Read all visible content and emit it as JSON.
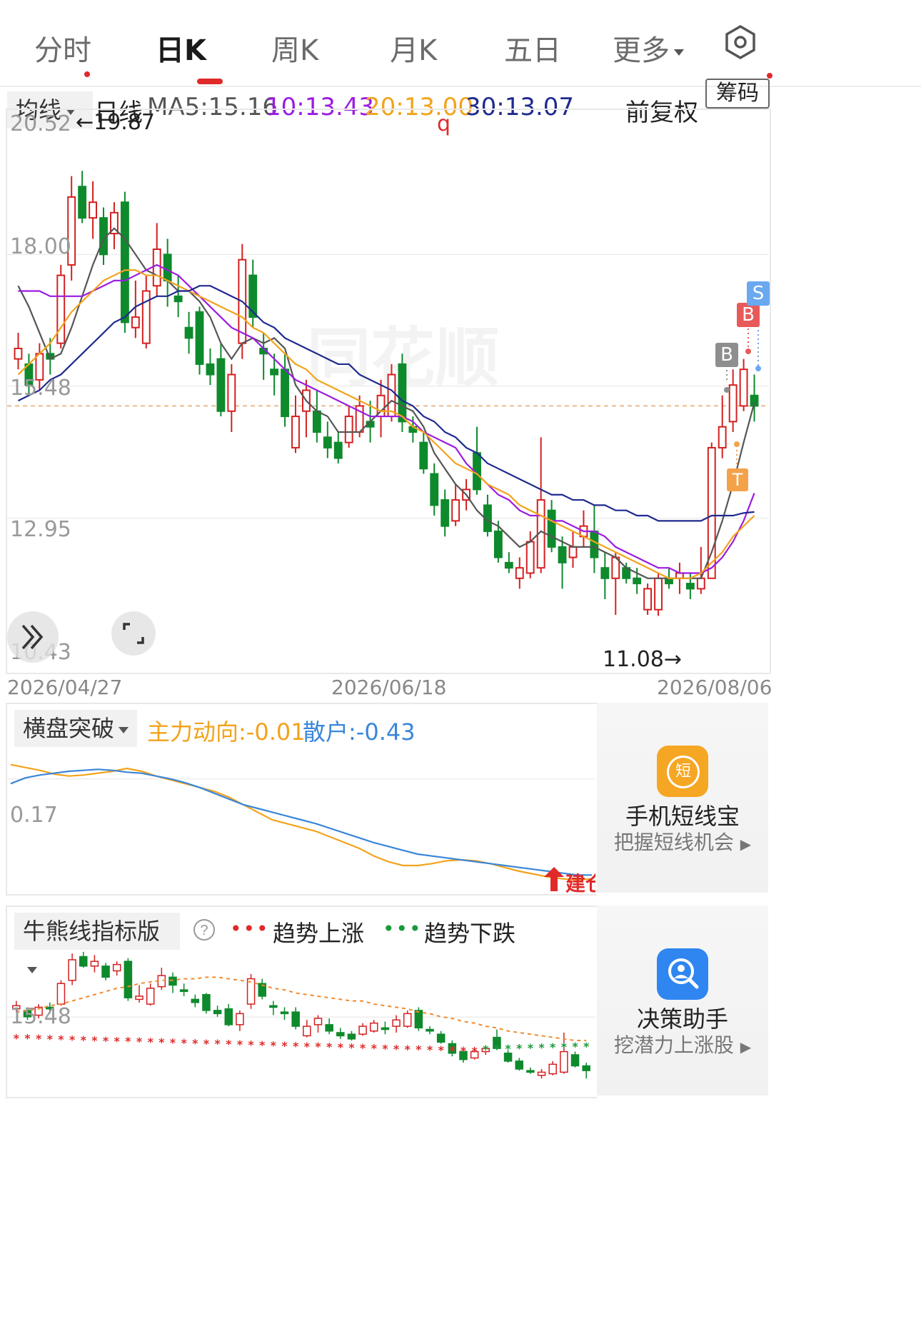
{
  "tabs": [
    {
      "label": "分时"
    },
    {
      "label": "日K"
    },
    {
      "label": "周K"
    },
    {
      "label": "月K"
    },
    {
      "label": "五日"
    },
    {
      "label": "更多"
    }
  ],
  "active_tab": "日K",
  "settings_icon": "hexagon-settings-icon",
  "ma_bar": {
    "selector": "均线",
    "period": "日线",
    "ma5": "MA5:15.16",
    "ma10": "10:13.43",
    "ma20": "20:13.00",
    "ma30": "30:13.07",
    "adjust": "前复权",
    "chips_button": "筹码",
    "colors": {
      "ma5": "#555555",
      "ma10": "#9b1ce0",
      "ma20": "#f2a31b",
      "ma30": "#1f2a8f"
    }
  },
  "main_chart": {
    "y_ticks": [
      "20.52",
      "18.00",
      "15.48",
      "12.95",
      "10.43"
    ],
    "x_dates": [
      "2026/04/27",
      "2026/06/18",
      "2026/08/06"
    ],
    "max_label": "←19.87",
    "min_label": "11.08→",
    "marker_top": "q",
    "signals": [
      "B",
      "B",
      "S",
      "T"
    ],
    "watermark": "同花顺"
  },
  "chart_data": {
    "type": "candlestick",
    "ylim": [
      10.43,
      20.52
    ],
    "candles": [
      {
        "o": 16.0,
        "c": 16.2,
        "h": 16.5,
        "l": 15.8
      },
      {
        "o": 15.9,
        "c": 15.5,
        "h": 16.1,
        "l": 15.3
      },
      {
        "o": 15.6,
        "c": 16.1,
        "h": 16.3,
        "l": 15.4
      },
      {
        "o": 16.1,
        "c": 16.0,
        "h": 16.4,
        "l": 15.7
      },
      {
        "o": 16.3,
        "c": 17.6,
        "h": 17.8,
        "l": 16.2
      },
      {
        "o": 17.8,
        "c": 19.1,
        "h": 19.5,
        "l": 17.5
      },
      {
        "o": 19.3,
        "c": 18.7,
        "h": 19.6,
        "l": 18.6
      },
      {
        "o": 18.7,
        "c": 19.0,
        "h": 19.4,
        "l": 18.3
      },
      {
        "o": 18.7,
        "c": 18.0,
        "h": 18.9,
        "l": 17.8
      },
      {
        "o": 18.4,
        "c": 18.8,
        "h": 19.0,
        "l": 18.1
      },
      {
        "o": 19.0,
        "c": 16.7,
        "h": 19.2,
        "l": 16.5
      },
      {
        "o": 16.6,
        "c": 16.8,
        "h": 17.5,
        "l": 16.4
      },
      {
        "o": 16.3,
        "c": 17.3,
        "h": 17.6,
        "l": 16.2
      },
      {
        "o": 17.4,
        "c": 18.1,
        "h": 18.6,
        "l": 17.2
      },
      {
        "o": 18.0,
        "c": 17.5,
        "h": 18.3,
        "l": 17.0
      },
      {
        "o": 17.2,
        "c": 17.1,
        "h": 17.6,
        "l": 16.8
      },
      {
        "o": 16.6,
        "c": 16.4,
        "h": 16.9,
        "l": 16.1
      },
      {
        "o": 16.9,
        "c": 15.9,
        "h": 17.0,
        "l": 15.7
      },
      {
        "o": 15.9,
        "c": 15.7,
        "h": 16.2,
        "l": 15.5
      },
      {
        "o": 16.0,
        "c": 15.0,
        "h": 16.3,
        "l": 14.9
      },
      {
        "o": 15.0,
        "c": 15.7,
        "h": 15.9,
        "l": 14.6
      },
      {
        "o": 16.3,
        "c": 17.9,
        "h": 18.2,
        "l": 16.0
      },
      {
        "o": 17.6,
        "c": 16.8,
        "h": 17.9,
        "l": 16.6
      },
      {
        "o": 16.2,
        "c": 16.1,
        "h": 16.5,
        "l": 15.6
      },
      {
        "o": 15.8,
        "c": 15.7,
        "h": 16.1,
        "l": 15.3
      },
      {
        "o": 15.8,
        "c": 14.9,
        "h": 16.1,
        "l": 14.7
      },
      {
        "o": 14.3,
        "c": 14.9,
        "h": 15.3,
        "l": 14.2
      },
      {
        "o": 15.0,
        "c": 15.4,
        "h": 15.6,
        "l": 14.5
      },
      {
        "o": 15.0,
        "c": 14.6,
        "h": 15.4,
        "l": 14.4
      },
      {
        "o": 14.5,
        "c": 14.3,
        "h": 14.8,
        "l": 14.1
      },
      {
        "o": 14.4,
        "c": 14.1,
        "h": 14.6,
        "l": 14.0
      },
      {
        "o": 14.4,
        "c": 14.9,
        "h": 15.1,
        "l": 14.3
      },
      {
        "o": 14.6,
        "c": 15.1,
        "h": 15.3,
        "l": 14.5
      },
      {
        "o": 14.8,
        "c": 14.7,
        "h": 15.2,
        "l": 14.4
      },
      {
        "o": 14.9,
        "c": 15.3,
        "h": 15.6,
        "l": 14.5
      },
      {
        "o": 14.9,
        "c": 15.7,
        "h": 15.9,
        "l": 14.8
      },
      {
        "o": 15.9,
        "c": 14.8,
        "h": 16.1,
        "l": 14.6
      },
      {
        "o": 14.7,
        "c": 14.6,
        "h": 14.9,
        "l": 14.4
      },
      {
        "o": 14.4,
        "c": 13.9,
        "h": 14.6,
        "l": 13.8
      },
      {
        "o": 13.8,
        "c": 13.2,
        "h": 14.0,
        "l": 13.0
      },
      {
        "o": 13.3,
        "c": 12.8,
        "h": 13.5,
        "l": 12.6
      },
      {
        "o": 12.9,
        "c": 13.3,
        "h": 13.6,
        "l": 12.8
      },
      {
        "o": 13.3,
        "c": 13.5,
        "h": 13.7,
        "l": 13.1
      },
      {
        "o": 14.2,
        "c": 13.5,
        "h": 14.7,
        "l": 13.4
      },
      {
        "o": 13.2,
        "c": 12.7,
        "h": 13.4,
        "l": 12.6
      },
      {
        "o": 12.7,
        "c": 12.2,
        "h": 12.9,
        "l": 12.1
      },
      {
        "o": 12.1,
        "c": 12.0,
        "h": 12.3,
        "l": 11.9
      },
      {
        "o": 11.8,
        "c": 12.0,
        "h": 12.2,
        "l": 11.6
      },
      {
        "o": 11.9,
        "c": 12.5,
        "h": 12.7,
        "l": 11.8
      },
      {
        "o": 12.0,
        "c": 13.3,
        "h": 14.5,
        "l": 11.9
      },
      {
        "o": 13.1,
        "c": 12.4,
        "h": 13.3,
        "l": 12.3
      },
      {
        "o": 12.4,
        "c": 12.1,
        "h": 12.6,
        "l": 11.6
      },
      {
        "o": 12.2,
        "c": 12.4,
        "h": 12.7,
        "l": 12.0
      },
      {
        "o": 12.6,
        "c": 12.8,
        "h": 13.1,
        "l": 12.4
      },
      {
        "o": 12.7,
        "c": 12.2,
        "h": 13.2,
        "l": 11.9
      },
      {
        "o": 12.0,
        "c": 11.8,
        "h": 12.3,
        "l": 11.4
      },
      {
        "o": 11.8,
        "c": 12.2,
        "h": 12.3,
        "l": 11.1
      },
      {
        "o": 12.0,
        "c": 11.8,
        "h": 12.1,
        "l": 11.7
      },
      {
        "o": 11.8,
        "c": 11.7,
        "h": 12.0,
        "l": 11.5
      },
      {
        "o": 11.2,
        "c": 11.6,
        "h": 11.7,
        "l": 11.1
      },
      {
        "o": 11.2,
        "c": 11.8,
        "h": 11.9,
        "l": 11.08
      },
      {
        "o": 11.8,
        "c": 11.7,
        "h": 12.0,
        "l": 11.6
      },
      {
        "o": 11.8,
        "c": 11.9,
        "h": 12.1,
        "l": 11.5
      },
      {
        "o": 11.7,
        "c": 11.6,
        "h": 11.9,
        "l": 11.4
      },
      {
        "o": 11.6,
        "c": 11.8,
        "h": 12.4,
        "l": 11.5
      },
      {
        "o": 11.8,
        "c": 14.3,
        "h": 14.4,
        "l": 11.8
      },
      {
        "o": 14.3,
        "c": 14.7,
        "h": 15.3,
        "l": 14.1
      },
      {
        "o": 14.8,
        "c": 15.5,
        "h": 15.8,
        "l": 14.6
      },
      {
        "o": 15.1,
        "c": 15.8,
        "h": 16.0,
        "l": 15.0
      },
      {
        "o": 15.3,
        "c": 15.1,
        "h": 15.7,
        "l": 14.8
      }
    ],
    "series": [
      {
        "name": "MA5",
        "color": "#555555",
        "values": [
          17.4,
          17.0,
          16.5,
          16.0,
          16.1,
          16.6,
          17.2,
          17.8,
          18.3,
          18.5,
          18.3,
          18.0,
          17.7,
          17.6,
          17.5,
          17.3,
          17.3,
          17.1,
          16.8,
          16.3,
          16.0,
          16.3,
          16.4,
          16.3,
          16.4,
          16.2,
          15.5,
          15.2,
          15.0,
          14.9,
          14.6,
          14.6,
          14.6,
          14.8,
          15.0,
          15.2,
          15.1,
          15.0,
          14.7,
          14.2,
          13.9,
          13.6,
          13.4,
          13.1,
          12.9,
          12.8,
          12.6,
          12.4,
          12.5,
          12.7,
          12.6,
          12.5,
          12.4,
          12.4,
          12.4,
          12.3,
          12.2,
          12.0,
          11.9,
          11.8,
          11.8,
          11.8,
          11.8,
          11.8,
          11.8,
          12.3,
          12.9,
          13.6,
          14.4,
          15.16
        ]
      },
      {
        "name": "MA10",
        "color": "#9b1ce0",
        "values": [
          17.3,
          17.3,
          17.3,
          17.2,
          17.2,
          17.2,
          17.2,
          17.3,
          17.4,
          17.5,
          17.5,
          17.6,
          17.7,
          17.8,
          17.7,
          17.6,
          17.4,
          17.2,
          17.0,
          16.8,
          16.6,
          16.5,
          16.4,
          16.2,
          16.0,
          15.8,
          15.6,
          15.5,
          15.4,
          15.3,
          15.2,
          15.1,
          15.0,
          14.9,
          14.9,
          14.9,
          14.9,
          14.8,
          14.6,
          14.5,
          14.4,
          14.3,
          14.0,
          13.8,
          13.6,
          13.4,
          13.3,
          13.1,
          13.0,
          13.0,
          12.9,
          12.9,
          12.8,
          12.7,
          12.7,
          12.6,
          12.4,
          12.3,
          12.2,
          12.1,
          12.0,
          12.0,
          11.9,
          11.9,
          11.9,
          12.0,
          12.2,
          12.5,
          12.9,
          13.43
        ]
      },
      {
        "name": "MA20",
        "color": "#f2a31b",
        "values": [
          15.7,
          15.9,
          16.1,
          16.3,
          16.6,
          16.9,
          17.1,
          17.3,
          17.5,
          17.6,
          17.7,
          17.7,
          17.6,
          17.6,
          17.5,
          17.4,
          17.3,
          17.2,
          17.1,
          17.0,
          16.9,
          16.8,
          16.6,
          16.5,
          16.3,
          16.1,
          15.9,
          15.8,
          15.6,
          15.5,
          15.4,
          15.3,
          15.2,
          15.1,
          15.0,
          15.0,
          14.9,
          14.7,
          14.6,
          14.4,
          14.2,
          14.0,
          13.9,
          13.8,
          13.6,
          13.5,
          13.4,
          13.2,
          13.1,
          13.0,
          12.9,
          12.8,
          12.7,
          12.6,
          12.5,
          12.4,
          12.3,
          12.2,
          12.1,
          12.0,
          11.9,
          11.8,
          11.8,
          11.8,
          11.9,
          12.1,
          12.3,
          12.6,
          12.8,
          13.0
        ]
      },
      {
        "name": "MA30",
        "color": "#1f2a8f",
        "values": [
          15.2,
          15.3,
          15.4,
          15.6,
          15.7,
          15.9,
          16.1,
          16.3,
          16.5,
          16.7,
          16.8,
          17.0,
          17.1,
          17.2,
          17.2,
          17.3,
          17.3,
          17.4,
          17.4,
          17.3,
          17.2,
          17.1,
          16.9,
          16.7,
          16.6,
          16.4,
          16.3,
          16.2,
          16.1,
          16.0,
          15.9,
          15.9,
          15.7,
          15.6,
          15.5,
          15.4,
          15.2,
          15.1,
          14.9,
          14.8,
          14.6,
          14.5,
          14.3,
          14.2,
          14.0,
          13.9,
          13.8,
          13.7,
          13.6,
          13.5,
          13.4,
          13.4,
          13.3,
          13.3,
          13.2,
          13.2,
          13.1,
          13.1,
          13.0,
          13.0,
          12.9,
          12.9,
          12.9,
          12.9,
          12.9,
          13.0,
          13.0,
          13.0,
          13.05,
          13.07
        ]
      }
    ]
  },
  "indicator1": {
    "selector": "横盘突破",
    "main_force": "主力动向:-0.01",
    "retail": "散户:-0.43",
    "y_tick": "0.17",
    "build_label": "建仓",
    "colors": {
      "main_force": "#f2a31b",
      "retail": "#3a86d8"
    },
    "main_force_values": [
      0.32,
      0.29,
      0.26,
      0.22,
      0.2,
      0.21,
      0.23,
      0.25,
      0.28,
      0.25,
      0.2,
      0.16,
      0.12,
      0.08,
      0.04,
      -0.02,
      -0.1,
      -0.18,
      -0.26,
      -0.3,
      -0.34,
      -0.38,
      -0.44,
      -0.5,
      -0.56,
      -0.64,
      -0.7,
      -0.74,
      -0.74,
      -0.72,
      -0.69,
      -0.68,
      -0.69,
      -0.72,
      -0.76,
      -0.8,
      -0.83,
      -0.86,
      -0.88,
      -0.89,
      -0.88
    ],
    "retail_values": [
      0.12,
      0.18,
      0.21,
      0.23,
      0.25,
      0.26,
      0.27,
      0.26,
      0.24,
      0.23,
      0.2,
      0.17,
      0.13,
      0.08,
      0.02,
      -0.04,
      -0.1,
      -0.14,
      -0.18,
      -0.22,
      -0.26,
      -0.3,
      -0.35,
      -0.4,
      -0.45,
      -0.5,
      -0.54,
      -0.58,
      -0.62,
      -0.64,
      -0.66,
      -0.68,
      -0.7,
      -0.72,
      -0.74,
      -0.76,
      -0.78,
      -0.8,
      -0.82,
      -0.84,
      -0.84
    ]
  },
  "indicator2": {
    "selector": "牛熊线指标版",
    "help_icon": "question-circle-icon",
    "up_label": "趋势上涨",
    "down_label": "趋势下跌",
    "y_tick": "15.48"
  },
  "side_ads": [
    {
      "title": "手机短线宝",
      "subtitle": "把握短线机会",
      "icon": "短",
      "icon_name": "short-term-treasure-icon"
    },
    {
      "title": "决策助手",
      "subtitle": "挖潜力上涨股",
      "icon": "",
      "icon_name": "decision-assistant-icon"
    }
  ]
}
